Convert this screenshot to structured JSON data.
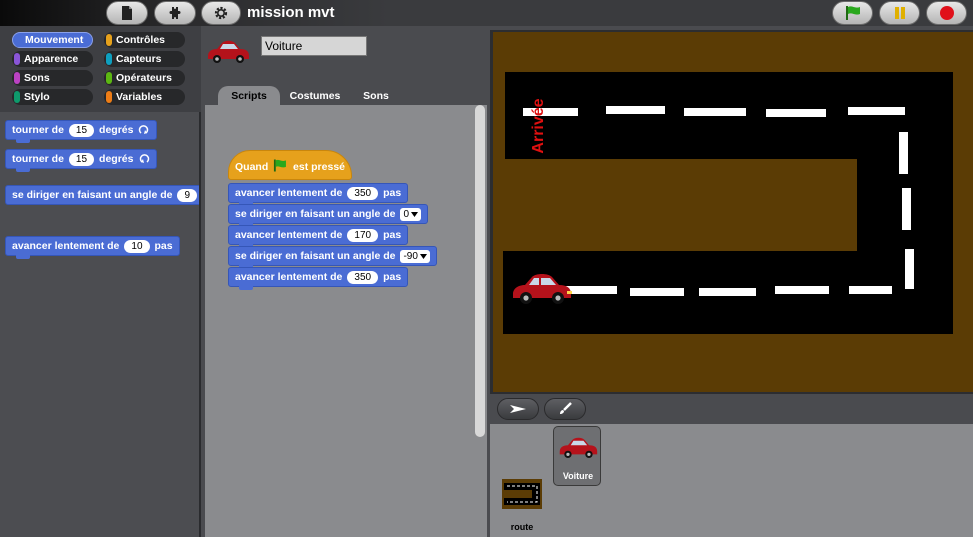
{
  "project": {
    "title": "mission mvt"
  },
  "toolbar": {
    "new_icon": "file-icon",
    "share_icon": "puzzle-icon",
    "settings_icon": "gear-icon",
    "green_flag_icon": "green-flag-icon",
    "pause_icon": "pause-icon",
    "stop_icon": "stop-icon"
  },
  "palette": {
    "categories": [
      {
        "label": "Mouvement",
        "color": "#4a6cd4",
        "selected": true
      },
      {
        "label": "Contrôles",
        "color": "#e6a11c"
      },
      {
        "label": "Apparence",
        "color": "#8a55d7"
      },
      {
        "label": "Capteurs",
        "color": "#0e9fbf"
      },
      {
        "label": "Sons",
        "color": "#bb42c3"
      },
      {
        "label": "Opérateurs",
        "color": "#5cb712"
      },
      {
        "label": "Stylo",
        "color": "#0e9a6c"
      },
      {
        "label": "Variables",
        "color": "#ee7d16"
      }
    ],
    "blocks": [
      {
        "text": "tourner de",
        "value": "15",
        "suffix": "degrés",
        "icon": "rotate-right-icon"
      },
      {
        "text": "tourner de",
        "value": "15",
        "suffix": "degrés",
        "icon": "rotate-left-icon"
      },
      {
        "text": "se diriger en faisant un angle de",
        "value": "9"
      },
      {
        "text": "avancer lentement de",
        "value": "10",
        "suffix": "pas"
      }
    ]
  },
  "sprite": {
    "name": "Voiture",
    "tabs": [
      "Scripts",
      "Costumes",
      "Sons"
    ],
    "selected_tab": "Scripts"
  },
  "script": {
    "hat": {
      "prefix": "Quand",
      "suffix": "est pressé",
      "icon": "green-flag-icon"
    },
    "blocks": [
      {
        "text": "avancer lentement de",
        "value": "350",
        "suffix": "pas"
      },
      {
        "text": "se diriger en faisant un angle de",
        "value": "0"
      },
      {
        "text": "avancer lentement de",
        "value": "170",
        "suffix": "pas"
      },
      {
        "text": "se diriger en faisant un angle de",
        "value": "-90"
      },
      {
        "text": "avancer lentement de",
        "value": "350",
        "suffix": "pas"
      }
    ]
  },
  "stage": {
    "finish_label": "Arrivée",
    "finish_color": "#e01010",
    "background_color": "#5b3c05",
    "road_color": "#000000"
  },
  "corral": {
    "stage_label": "route",
    "sprite_label": "Voiture",
    "arrow_icon": "arrow-icon",
    "paint_icon": "paintbrush-icon"
  }
}
